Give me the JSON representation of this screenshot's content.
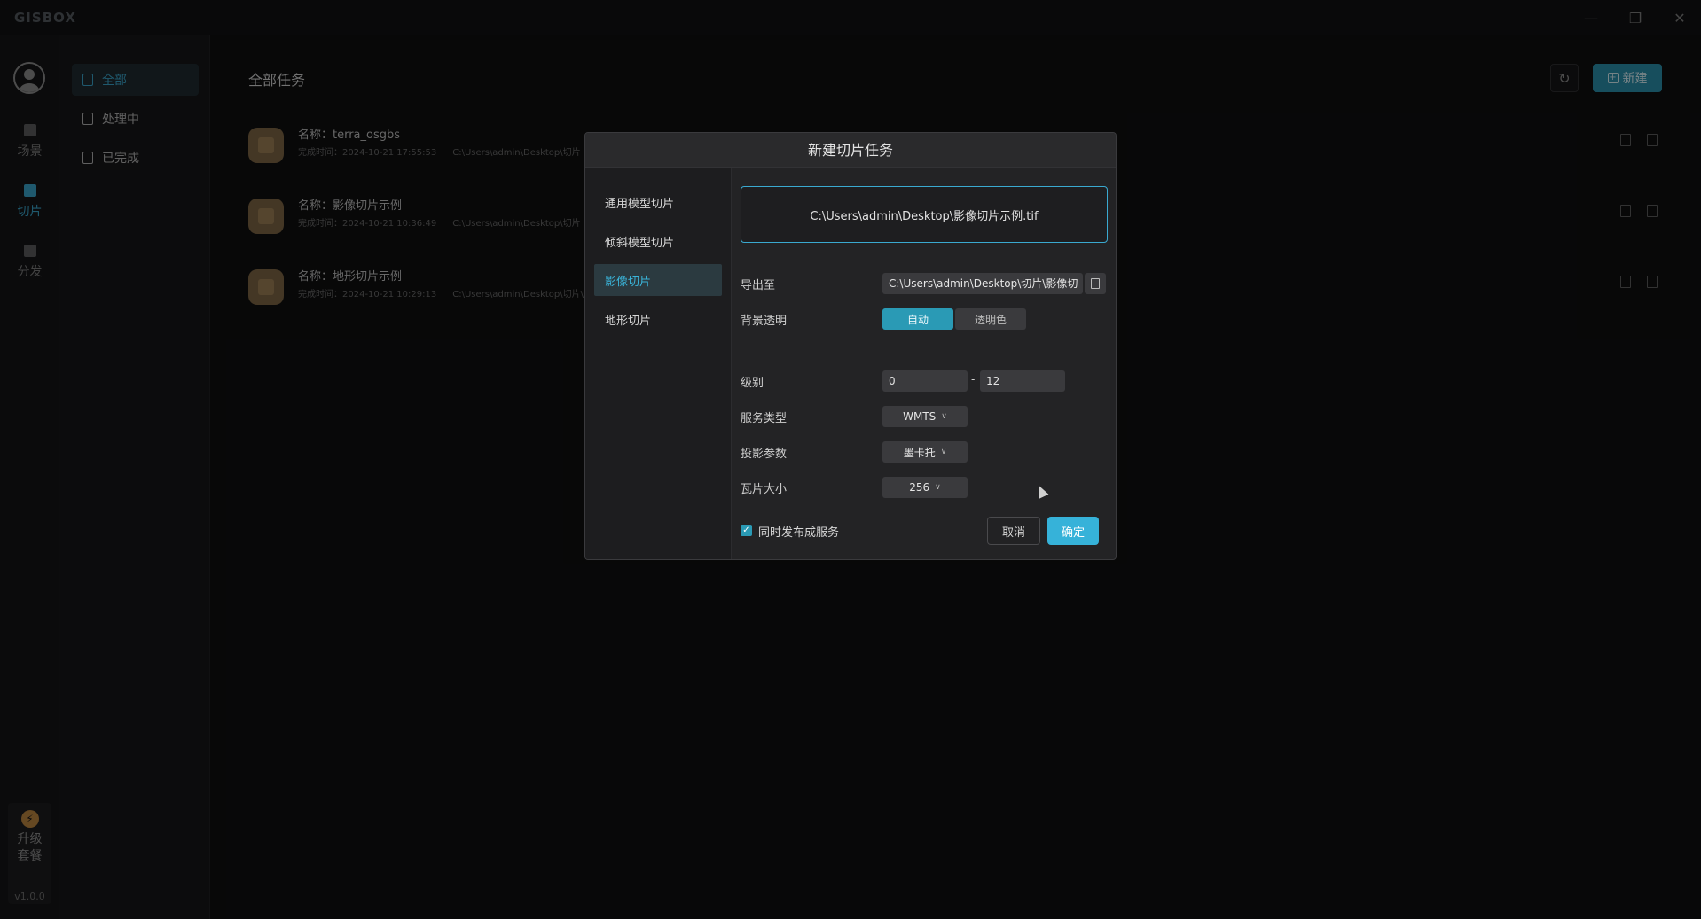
{
  "app": {
    "logo": "GISBOX",
    "version": "v1.0.0",
    "window_controls": [
      "minimize-icon",
      "restore-icon",
      "close-icon"
    ]
  },
  "rail": {
    "items": [
      {
        "label": "场景",
        "icon": "scene-icon"
      },
      {
        "label": "切片",
        "icon": "tile-icon",
        "active": true
      },
      {
        "label": "分发",
        "icon": "distribute-icon"
      }
    ],
    "upgrade_line1": "升级",
    "upgrade_line2": "套餐"
  },
  "subnav": {
    "items": [
      {
        "label": "全部",
        "active": true
      },
      {
        "label": "处理中"
      },
      {
        "label": "已完成"
      }
    ]
  },
  "main": {
    "title": "全部任务",
    "new_label": "新建",
    "tasks": [
      {
        "name": "名称：terra_osgbs",
        "time": "完成时间：2024-10-21 17:55:53",
        "path": "C:\\Users\\admin\\Desktop\\切片"
      },
      {
        "name": "名称：影像切片示例",
        "time": "完成时间：2024-10-21 10:36:49",
        "path": "C:\\Users\\admin\\Desktop\\切片"
      },
      {
        "name": "名称：地形切片示例",
        "time": "完成时间：2024-10-21 10:29:13",
        "path": "C:\\Users\\admin\\Desktop\\切片\\"
      }
    ]
  },
  "modal": {
    "title": "新建切片任务",
    "tabs": [
      {
        "label": "通用模型切片"
      },
      {
        "label": "倾斜模型切片"
      },
      {
        "label": "影像切片",
        "active": true
      },
      {
        "label": "地形切片"
      }
    ],
    "file_path": "C:\\Users\\admin\\Desktop\\影像切片示例.tif",
    "export_label": "导出至",
    "export_path": "C:\\Users\\admin\\Desktop\\切片\\影像切",
    "bg_label": "背景透明",
    "bg_auto": "自动",
    "bg_transparent": "透明色",
    "level_label": "级别",
    "level_min": "0",
    "level_sep": "-",
    "level_max": "12",
    "service_label": "服务类型",
    "service_value": "WMTS",
    "projection_label": "投影参数",
    "projection_value": "墨卡托",
    "tile_label": "瓦片大小",
    "tile_value": "256",
    "publish_label": "同时发布成服务",
    "publish_checked": true,
    "cancel_label": "取消",
    "ok_label": "确定"
  },
  "colors": {
    "accent": "#36b2d9",
    "accent_dark": "#2a9ab5",
    "background": "#0f0f10"
  }
}
